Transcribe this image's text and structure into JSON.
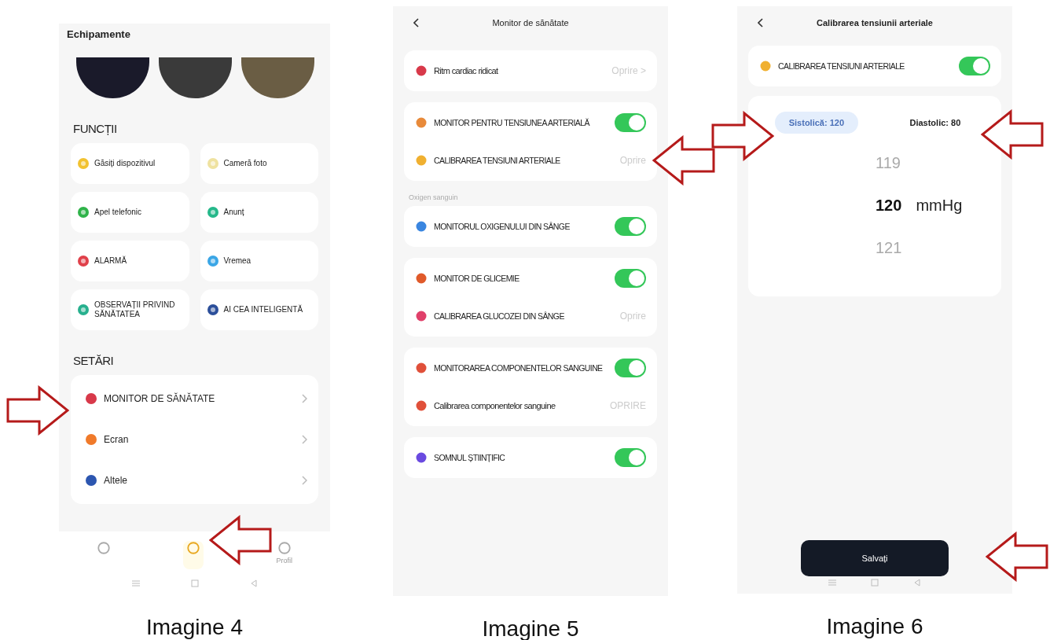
{
  "screen_equipment": {
    "caption": "Imagine 4",
    "title": "Echipamente",
    "functions_heading": "FUNCȚII",
    "functions": [
      {
        "label": "Găsiți dispozitivul"
      },
      {
        "label": "Cameră foto"
      },
      {
        "label": "Apel telefonic"
      },
      {
        "label": "Anunț"
      },
      {
        "label": "ALARMĂ"
      },
      {
        "label": "Vremea"
      },
      {
        "label": "OBSERVAȚII PRIVIND SĂNĂTATEA"
      },
      {
        "label": "AI CEA INTELIGENTĂ"
      }
    ],
    "settings_heading": "SETĂRI",
    "settings": [
      {
        "label": "MONITOR DE SĂNĂTATE"
      },
      {
        "label": "Ecran"
      },
      {
        "label": "Altele"
      }
    ],
    "nav": [
      {
        "selected": false
      },
      {
        "selected": true
      },
      {
        "label": "Profil",
        "selected": false
      }
    ]
  },
  "screen_health_monitor": {
    "caption": "Imagine 5",
    "title": "Monitor de sănătate",
    "groups": [
      {
        "rows": [
          {
            "kind": "value",
            "label": "Ritm cardiac ridicat",
            "value": "Oprire >"
          }
        ]
      },
      {
        "rows": [
          {
            "kind": "toggle",
            "label": "MONITOR PENTRU TENSIUNEA ARTERIALĂ",
            "on": true
          },
          {
            "kind": "value",
            "label": "CALIBRAREA TENSIUNI ARTERIALE",
            "value": "Oprire"
          }
        ]
      },
      {
        "section": "Oxigen sanguin",
        "rows": [
          {
            "kind": "toggle",
            "label": "MONITORUL OXIGENULUI DIN SÂNGE",
            "on": true
          }
        ]
      },
      {
        "rows": [
          {
            "kind": "toggle",
            "label": "MONITOR DE GLICEMIE",
            "on": true
          },
          {
            "kind": "value",
            "label": "CALIBRAREA GLUCOZEI DIN SÂNGE",
            "value": "Oprire"
          }
        ]
      },
      {
        "rows": [
          {
            "kind": "toggle",
            "label": "MONITORAREA COMPONENTELOR SANGUINE",
            "on": true
          },
          {
            "kind": "value",
            "label": "Calibrarea componentelor sanguine",
            "value": "OPRIRE"
          }
        ]
      },
      {
        "rows": [
          {
            "kind": "toggle",
            "label": "SOMNUL ȘTIINȚIFIC",
            "on": true
          }
        ]
      }
    ]
  },
  "screen_calibration": {
    "caption": "Imagine 6",
    "title": "Calibrarea tensiunii arteriale",
    "toggle": {
      "label": "CALIBRAREA TENSIUNI ARTERIALE",
      "on": true
    },
    "tabs": [
      {
        "label": "Sistolică: 120",
        "selected": true
      },
      {
        "label": "Diastolic: 80",
        "selected": false
      }
    ],
    "wheel": [
      {
        "value": "119",
        "selected": false
      },
      {
        "value": "120",
        "selected": true
      },
      {
        "value": "121",
        "selected": false
      }
    ],
    "unit": "mmHg",
    "save_button": "Salvați"
  }
}
